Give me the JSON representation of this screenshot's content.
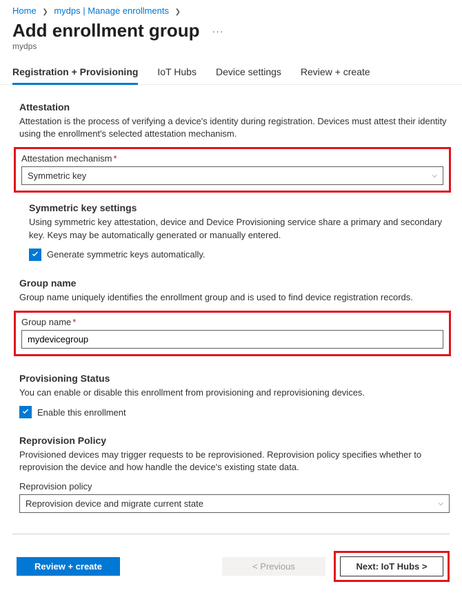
{
  "breadcrumb": {
    "home": "Home",
    "path1": "mydps | Manage enrollments"
  },
  "page": {
    "title": "Add enrollment group",
    "subtitle": "mydps",
    "ellipsis": "···"
  },
  "tabs": {
    "t0": "Registration + Provisioning",
    "t1": "IoT Hubs",
    "t2": "Device settings",
    "t3": "Review + create"
  },
  "attestation": {
    "header": "Attestation",
    "desc": "Attestation is the process of verifying a device's identity during registration. Devices must attest their identity using the enrollment's selected attestation mechanism.",
    "mechanism_label": "Attestation mechanism",
    "mechanism_value": "Symmetric key"
  },
  "symkey": {
    "header": "Symmetric key settings",
    "desc": "Using symmetric key attestation, device and Device Provisioning service share a primary and secondary key. Keys may be automatically generated or manually entered.",
    "checkbox_label": "Generate symmetric keys automatically."
  },
  "group": {
    "header": "Group name",
    "desc": "Group name uniquely identifies the enrollment group and is used to find device registration records.",
    "field_label": "Group name",
    "field_value": "mydevicegroup"
  },
  "provisioning": {
    "header": "Provisioning Status",
    "desc": "You can enable or disable this enrollment from provisioning and reprovisioning devices.",
    "checkbox_label": "Enable this enrollment"
  },
  "reprovision": {
    "header": "Reprovision Policy",
    "desc": "Provisioned devices may trigger requests to be reprovisioned. Reprovision policy specifies whether to reprovision the device and how handle the device's existing state data.",
    "field_label": "Reprovision policy",
    "field_value": "Reprovision device and migrate current state"
  },
  "footer": {
    "review": "Review + create",
    "previous": "< Previous",
    "next": "Next: IoT Hubs >"
  }
}
